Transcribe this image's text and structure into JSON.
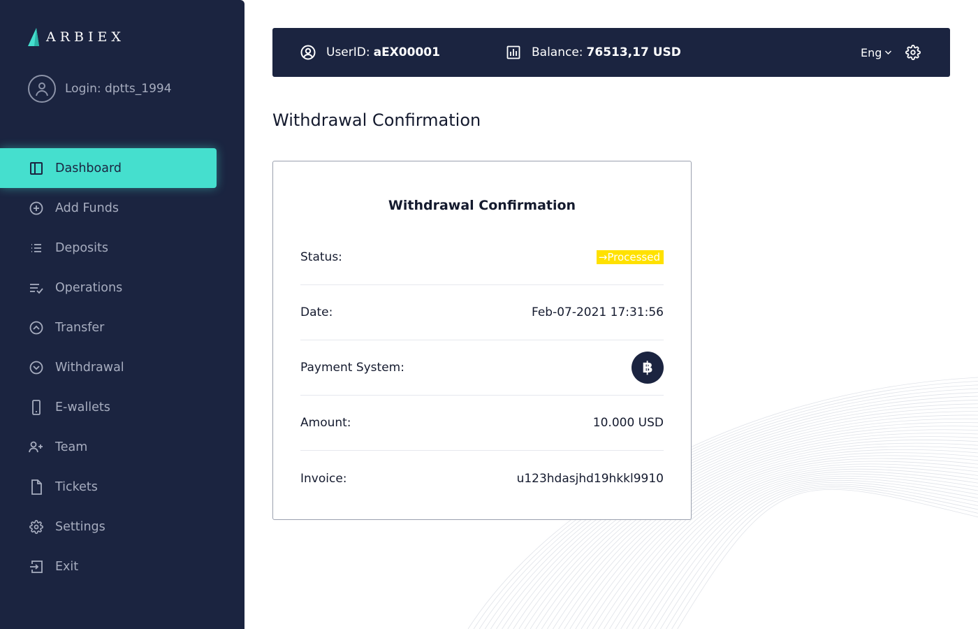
{
  "brand": {
    "name": "ARBIEX"
  },
  "user": {
    "login": "Login: dptts_1994"
  },
  "nav": [
    {
      "label": "Dashboard",
      "icon": "layout-icon",
      "active": true
    },
    {
      "label": "Add Funds",
      "icon": "plus-circle-icon"
    },
    {
      "label": "Deposits",
      "icon": "list-icon"
    },
    {
      "label": "Operations",
      "icon": "list-check-icon"
    },
    {
      "label": "Transfer",
      "icon": "chevron-up-circle-icon"
    },
    {
      "label": "Withdrawal",
      "icon": "chevron-down-circle-icon"
    },
    {
      "label": "E-wallets",
      "icon": "phone-icon"
    },
    {
      "label": "Team",
      "icon": "user-plus-icon"
    },
    {
      "label": "Tickets",
      "icon": "file-icon"
    },
    {
      "label": "Settings",
      "icon": "gear-icon"
    },
    {
      "label": "Exit",
      "icon": "exit-icon"
    }
  ],
  "topbar": {
    "user_label": "UserID:",
    "user_id": "aEX00001",
    "balance_label": "Balance:",
    "balance_value": "76513,17 USD",
    "language": "Eng"
  },
  "page": {
    "title": "Withdrawal Confirmation"
  },
  "card": {
    "title": "Withdrawal Confirmation",
    "status_label": "Status:",
    "status_value": "→Processed",
    "date_label": "Date:",
    "date_value": "Feb-07-2021 17:31:56",
    "payment_label": "Payment System:",
    "payment_symbol": "฿",
    "amount_label": "Amount:",
    "amount_value": "10.000 USD",
    "invoice_label": "Invoice:",
    "invoice_value": "u123hdasjhd19hkkl9910"
  },
  "colors": {
    "sidebar": "#1b2440",
    "accent": "#45dfce",
    "status_badge": "#ffe100",
    "muted_text": "#a7adbf"
  }
}
